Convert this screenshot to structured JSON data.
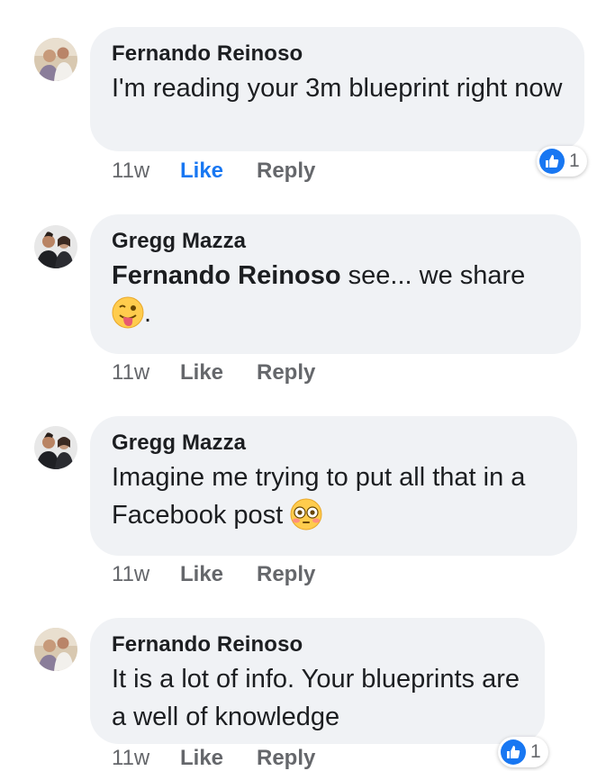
{
  "comments": [
    {
      "author": "Fernando Reinoso",
      "text": "I'm reading your 3m blueprint right now",
      "time": "11w",
      "like_label": "Like",
      "reply_label": "Reply",
      "liked": true,
      "reaction_count": "1",
      "avatar_icon": "profile-photo-icon"
    },
    {
      "author": "Gregg Mazza",
      "mention": "Fernando Reinoso",
      "text": " see... we share",
      "text_after_emoji": ".",
      "emoji": "winking-face-with-tongue-emoji",
      "time": "11w",
      "like_label": "Like",
      "reply_label": "Reply",
      "avatar_icon": "profile-photo-icon"
    },
    {
      "author": "Gregg Mazza",
      "text": "Imagine me trying to put all that in a Facebook post",
      "emoji": "flushed-face-emoji",
      "time": "11w",
      "like_label": "Like",
      "reply_label": "Reply",
      "avatar_icon": "profile-photo-icon"
    },
    {
      "author": "Fernando Reinoso",
      "text": "It is a lot of info. Your blueprints are a well of knowledge",
      "time": "11w",
      "like_label": "Like",
      "reply_label": "Reply",
      "reaction_count": "1",
      "avatar_icon": "profile-photo-icon"
    }
  ],
  "colors": {
    "bubble": "#f0f2f5",
    "accent": "#1877f2",
    "meta": "#65676b",
    "text": "#1c1e21"
  }
}
